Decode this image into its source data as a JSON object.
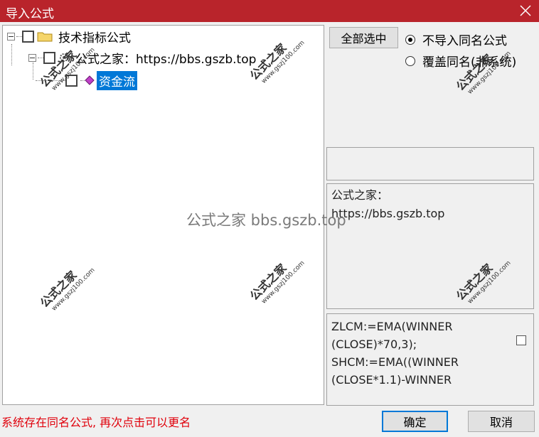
{
  "window": {
    "title": "导入公式"
  },
  "tree": {
    "root": {
      "label": "技术指标公式"
    },
    "child": {
      "label": "公式之家：https://bbs.gszb.top"
    },
    "leaf": {
      "label": "资金流"
    }
  },
  "right_panel": {
    "select_all_button": "全部选中",
    "options": [
      {
        "label": "不导入同名公式",
        "selected": true
      },
      {
        "label": "覆盖同名(非系统)",
        "selected": false
      }
    ],
    "description": [
      "公式之家：",
      "https://bbs.gszb.top"
    ],
    "code": "ZLCM:=EMA(WINNER\n(CLOSE)*70,3);\nSHCM:=EMA((WINNER\n(CLOSE*1.1)-WINNER"
  },
  "status": {
    "message": "系统存在同名公式, 再次点击可以更名"
  },
  "buttons": {
    "ok": "确定",
    "cancel": "取消"
  },
  "watermarks": {
    "center": "公式之家 bbs.gszb.top",
    "stamp_title": "公式之家",
    "stamp_url": "www.gszj100.com"
  },
  "colors": {
    "titlebar": "#b9242b",
    "selection": "#0078d7",
    "status_text": "#e0000b"
  }
}
